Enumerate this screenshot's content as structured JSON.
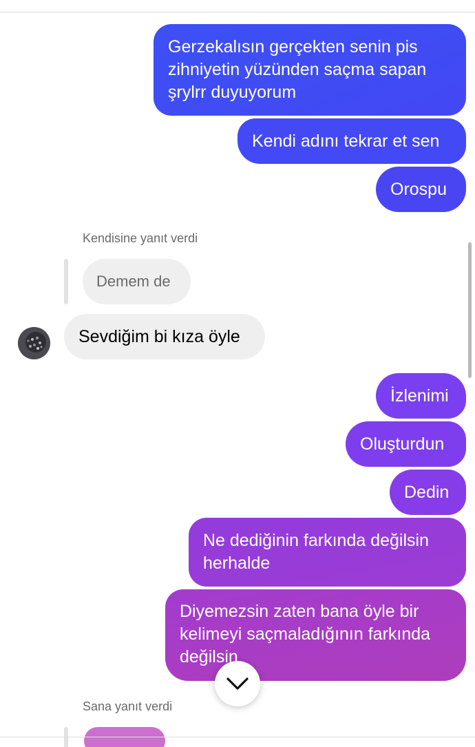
{
  "messages_outgoing_top": [
    {
      "text": "Gerzekalısın gerçekten senin pis zihniyetin yüzünden saçma sapan şrylrr duyuyorum",
      "lines": [
        "Gerzekalısın gerçekten senin pis",
        "zihniyetin yüzünden saçma sapan",
        "şrylrr duyuyorum"
      ],
      "color": "#3f4ff4"
    },
    {
      "text": "Kendi adını tekrar et sen",
      "color": "#4349f4"
    },
    {
      "text": "Orospu",
      "color": "#4a45f2"
    }
  ],
  "reply_context_1": {
    "label": "Kendisine yanıt verdi",
    "quoted_text": "Demem de"
  },
  "message_incoming": {
    "text": "Sevdiğim bi kıza öyle"
  },
  "messages_outgoing_bottom": [
    {
      "text": "İzlenimi",
      "color": "#7a3ff0"
    },
    {
      "text": "Oluşturdun",
      "color": "#7e3eed"
    },
    {
      "text": "Dedin",
      "color": "#863ce8"
    },
    {
      "text": "Ne dediğinin farkında değilsin herhalde",
      "lines": [
        "Ne dediğinin farkında değilsin",
        "herhalde"
      ],
      "color": "#983cd8"
    },
    {
      "text": "Diyemezsin zaten bana öyle bir kelimeyi saçmaladığının farkında değilsin",
      "lines": [
        "Diyemezsin zaten bana öyle bir",
        "kelimeyi saçmaladığının farkında",
        "değilsin"
      ],
      "color": "#a83dc4"
    }
  ],
  "reply_context_2": {
    "label": "Sana yanıt verdi"
  },
  "icons": {
    "scroll_down": "chevron-down-icon",
    "avatar": "contact-avatar"
  }
}
